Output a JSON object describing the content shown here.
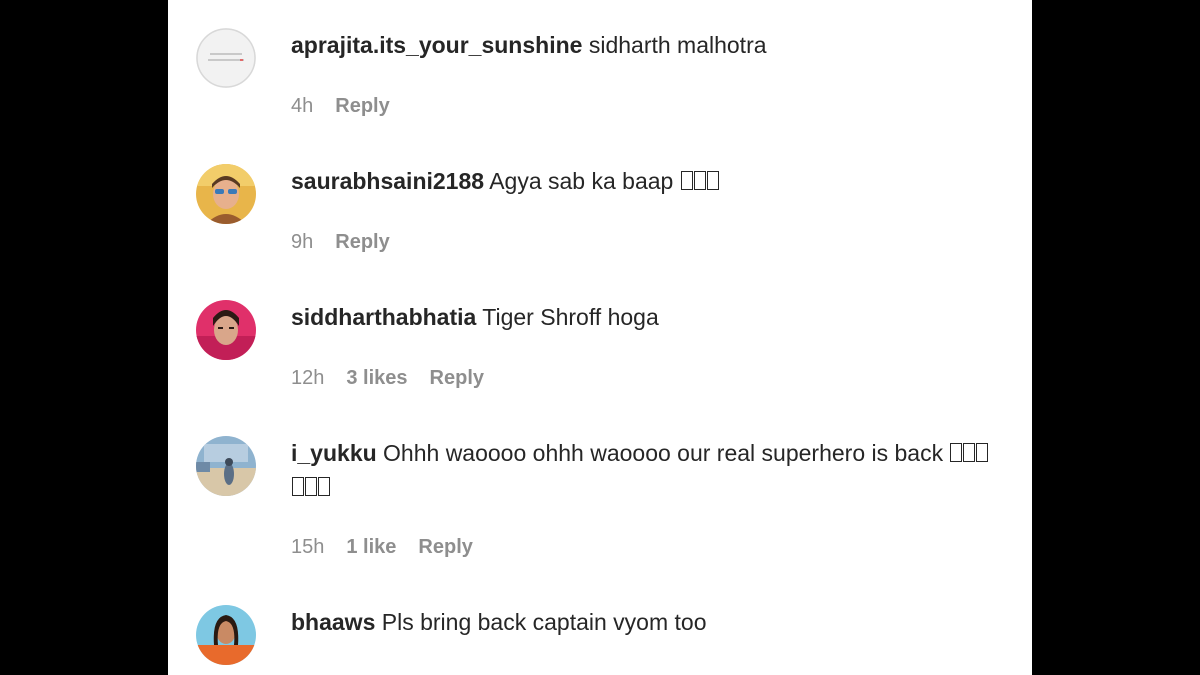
{
  "comments": [
    {
      "username": "aprajita.its_your_sunshine",
      "text": "sidharth malhotra",
      "emoji_boxes": 0,
      "time": "4h",
      "likes": "",
      "reply": "Reply"
    },
    {
      "username": "saurabhsaini2188",
      "text": "Agya sab ka baap",
      "emoji_boxes": 3,
      "time": "9h",
      "likes": "",
      "reply": "Reply"
    },
    {
      "username": "siddharthabhatia",
      "text": "Tiger Shroff hoga",
      "emoji_boxes": 0,
      "time": "12h",
      "likes": "3 likes",
      "reply": "Reply"
    },
    {
      "username": "i_yukku",
      "text": "Ohhh waoooo ohhh waoooo our real superhero is back",
      "emoji_boxes": 6,
      "time": "15h",
      "likes": "1 like",
      "reply": "Reply"
    },
    {
      "username": "bhaaws",
      "text": "Pls bring back captain vyom too",
      "emoji_boxes": 0,
      "time": "",
      "likes": "",
      "reply": ""
    }
  ],
  "colors": {
    "page_background": "#000000",
    "panel_background": "#ffffff",
    "username": "#262626",
    "text": "#262626",
    "meta": "#8e8e8e"
  }
}
